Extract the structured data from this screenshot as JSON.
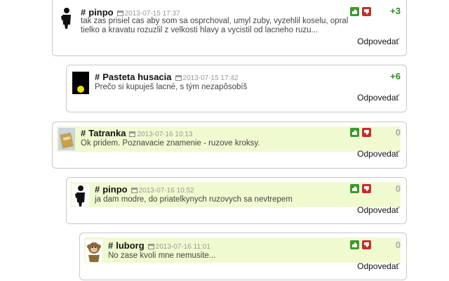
{
  "reply_label": "Odpovedať",
  "comments": [
    {
      "author": "pinpo",
      "date": "2013-07-15 17:37",
      "score": "+3",
      "text_lines": [
        "tak zas prisiel cas aby som sa osprchoval, umyl zuby, vyzehlil koselu, opral",
        "tielko a kravatu rozuzlil z velkosti hlavy a vycistil od lacneho ruzu..."
      ]
    },
    {
      "author": "Pasteta husacia",
      "date": "2013-07-15 17:42",
      "score": "+6",
      "text_lines": [
        "Prečo si kupuješ lacné, s tým nezapôsobíš"
      ]
    },
    {
      "author": "Tatranka",
      "date": "2013-07-16 10:13",
      "score": "0",
      "text_lines": [
        "Ok pridem. Poznavacie znamenie - ruzove kroksy."
      ]
    },
    {
      "author": "pinpo",
      "date": "2013-07-16 10:52",
      "score": "0",
      "text_lines": [
        "ja dam modre, do priatelkynych ruzovych sa nevtrepem"
      ]
    },
    {
      "author": "luborg",
      "date": "2013-07-16 11:01",
      "score": "0",
      "text_lines": [
        "No zase kvoli mne nemusite..."
      ]
    }
  ],
  "colors": {
    "highlight": "#f0fad0",
    "vote_up": "#3c9a2c",
    "vote_down": "#c82c2c",
    "score_positive": "#2e8b1e",
    "score_zero": "#aaaaaa"
  },
  "icons": [
    "calendar-icon",
    "thumb-up-icon",
    "thumb-down-icon"
  ]
}
